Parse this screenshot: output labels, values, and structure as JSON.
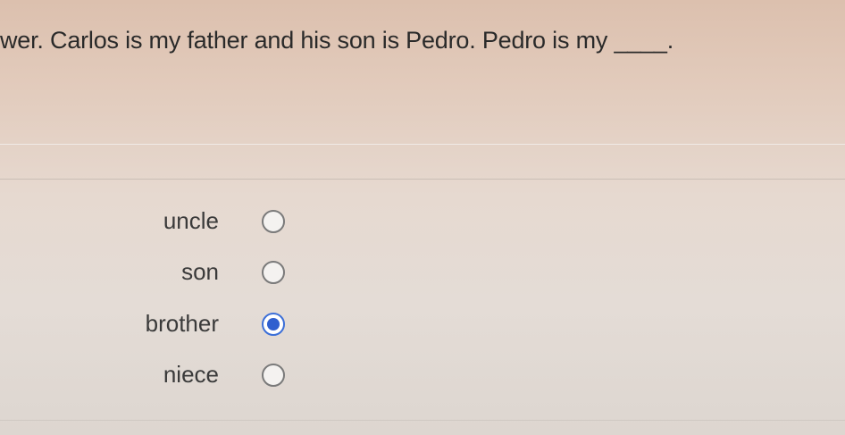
{
  "question": {
    "text": "wer. Carlos is my father and his son is Pedro. Pedro is my ____."
  },
  "options": [
    {
      "label": "uncle",
      "selected": false
    },
    {
      "label": "son",
      "selected": false
    },
    {
      "label": "brother",
      "selected": true
    },
    {
      "label": "niece",
      "selected": false
    }
  ],
  "colors": {
    "radio_selected": "#2f5fcf",
    "radio_border": "#7a7a7a",
    "text": "#2a2a2a"
  }
}
